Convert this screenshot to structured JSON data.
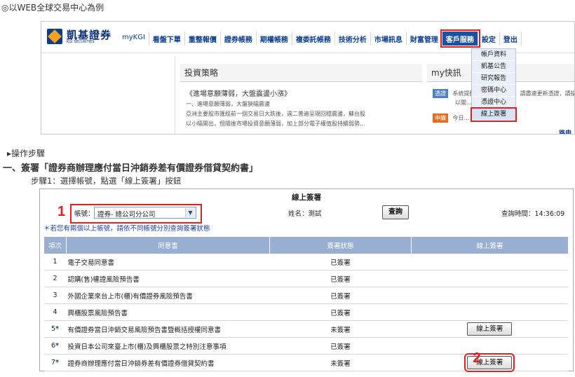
{
  "intro": "◎以WEB全球交易中心為例",
  "site": {
    "logo_name": "凱基證券",
    "logo_sub": "KGI SECURITIES",
    "nav": [
      "myKGI",
      "看盤下單",
      "重整報價",
      "證券帳務",
      "期權帳務",
      "複委託帳務",
      "技術分析",
      "市場訊息",
      "財富管理",
      "客戶服務",
      "設定",
      "登出"
    ],
    "dropdown": [
      "帳戶資料",
      "凱基公告",
      "研究報告",
      "密碼中心",
      "憑證中心",
      "線上簽署"
    ],
    "strategy_title": "投資策略",
    "strategy_head": "《進場意願薄弱，大盤震盪小漲》",
    "strategy_lines": [
      "一、進場意願薄弱，大盤狹幅震盪",
      "亞洲主要股市匯經前一個交易日大跌後，週二普遍呈現回穩震盪，蘇台股",
      "以小幅開出，但隨後市場投資意願薄弱，加上部分電子權值股持續弱勢..."
    ],
    "news_title": "my快訊",
    "news_tag1": "憑證",
    "news_line1": "系統提醒您憑證即將到期，請盡速更新憑證，請操",
    "news_line1b": "以關…",
    "news_tag2": "申購",
    "news_line2": "今日…",
    "news_link": "路申購"
  },
  "steps_label": "▸操作步驟",
  "step_heading": "一、簽署「證券商辦理應付當日沖銷券差有價證券借貸契約書」",
  "step1": "步驟1：選擇帳號，點選「線上簽署」按鈕",
  "form": {
    "title": "線上簽署",
    "marker1": "1",
    "marker2": "2",
    "account_label": "帳號：",
    "account_value": "證券- 總公司分公司",
    "name_label": "姓名：測試",
    "query_button": "查詢",
    "query_time": "查詢時間：14:36:09",
    "note": "＊若您有兩個以上帳號，請依不同帳號分別查詢簽署狀態",
    "columns": [
      "項次",
      "同意書",
      "簽署狀態",
      "線上簽署"
    ],
    "rows": [
      {
        "no": "1",
        "star": "",
        "name": "電子交易同意書",
        "status": "已簽署",
        "action": ""
      },
      {
        "no": "2",
        "star": "",
        "name": "認購(售)權證風險預告書",
        "status": "已簽署",
        "action": ""
      },
      {
        "no": "3",
        "star": "",
        "name": "外國企業來台上市(櫃)有價證券風險預告書",
        "status": "已簽署",
        "action": ""
      },
      {
        "no": "4",
        "star": "",
        "name": "興櫃股票風險預告書",
        "status": "已簽署",
        "action": ""
      },
      {
        "no": "5",
        "star": "*",
        "name": "有價證券當日沖銷交易風險預告書暨概括授權同意書",
        "status": "未簽署",
        "action": "線上簽署"
      },
      {
        "no": "6",
        "star": "*",
        "name": "投資日本公司來臺上市(櫃)及興櫃股票之特別注意事項",
        "status": "已簽署",
        "action": ""
      },
      {
        "no": "7",
        "star": "*",
        "name": "證券商辦理應付當日沖銷券差有價證券借貸契約書",
        "status": "未簽署",
        "action": "線上簽署"
      }
    ]
  },
  "colors": {
    "accent_red": "#e0201e",
    "header_blue": "#98afd1",
    "nav_blue": "#0a3d8f"
  }
}
